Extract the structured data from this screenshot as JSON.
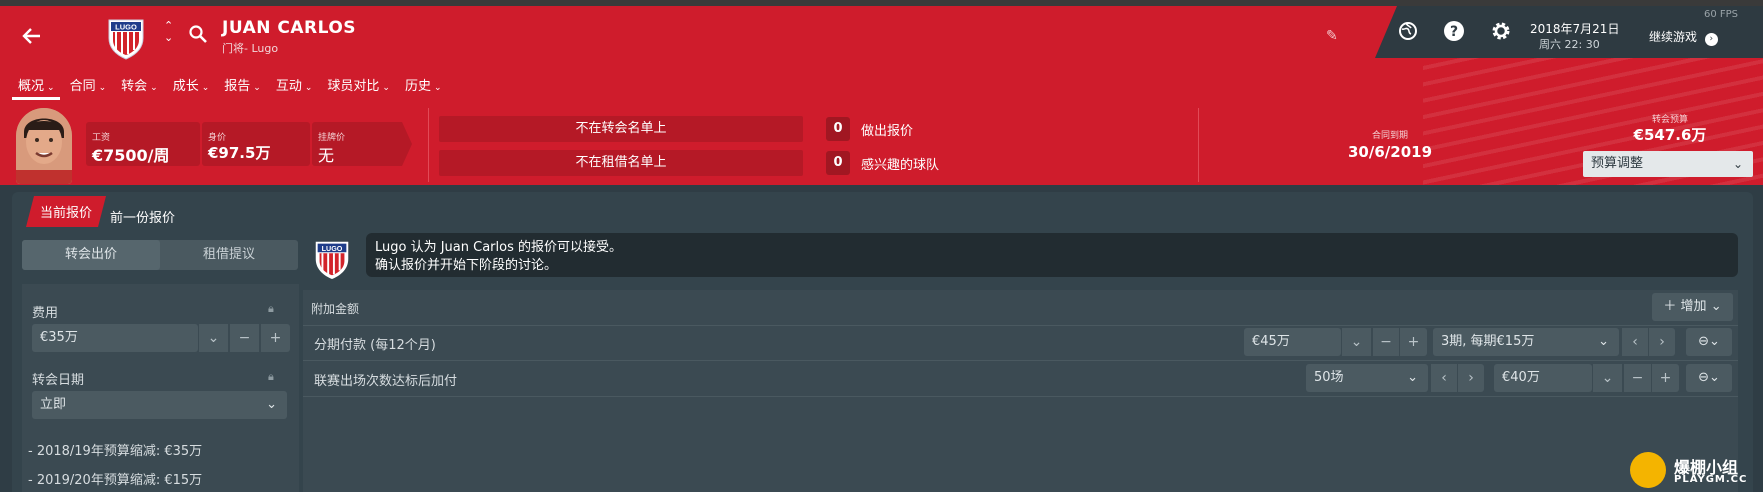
{
  "header": {
    "name": "JUAN CARLOS",
    "subtitle": "门将- Lugo",
    "date": "2018年7月21日",
    "time": "周六 22: 30",
    "continue": "继续游戏",
    "fps": "60 FPS"
  },
  "nav": [
    "概况",
    "合同",
    "转会",
    "成长",
    "报告",
    "互动",
    "球员对比",
    "历史"
  ],
  "stats": {
    "wage_label": "工资",
    "wage": "€7500/周",
    "value_label": "身价",
    "value": "€97.5万",
    "asking_label": "挂牌价",
    "asking": "无"
  },
  "lists": {
    "transfer": "不在转会名单上",
    "loan": "不在租借名单上"
  },
  "counts": {
    "offers_count": "0",
    "offers_label": "做出报价",
    "interested_count": "0",
    "interested_label": "感兴趣的球队"
  },
  "contract": {
    "label": "合同到期",
    "value": "30/6/2019"
  },
  "budget": {
    "label": "转会预算",
    "value": "€547.6万",
    "adjust": "预算调整"
  },
  "tabs": {
    "current": "当前报价",
    "previous": "前一份报价"
  },
  "segment": {
    "transfer": "转会出价",
    "loan": "租借提议"
  },
  "message": {
    "line1": "Lugo 认为 Juan Carlos 的报价可以接受。",
    "line2": "确认报价并开始下阶段的讨论。"
  },
  "fee": {
    "label": "费用",
    "value": "€35万"
  },
  "date_field": {
    "label": "转会日期",
    "value": "立即"
  },
  "budget_notes": [
    "- 2018/19年预算缩减: €35万",
    "- 2019/20年预算缩减: €15万"
  ],
  "addons": {
    "title": "附加金额",
    "add": "增加",
    "rows": [
      {
        "label": "分期付款 (每12个月)",
        "amount": "€45万",
        "detail": "3期, 每期€15万"
      },
      {
        "label": "联赛出场次数达标后加付",
        "amount": "50场",
        "detail": "€40万"
      }
    ]
  },
  "watermark": {
    "text": "爆棚小组",
    "url": "PLAYGM.CC"
  },
  "colors": {
    "header_red": "#cf1c2c",
    "panel": "#34444c"
  }
}
